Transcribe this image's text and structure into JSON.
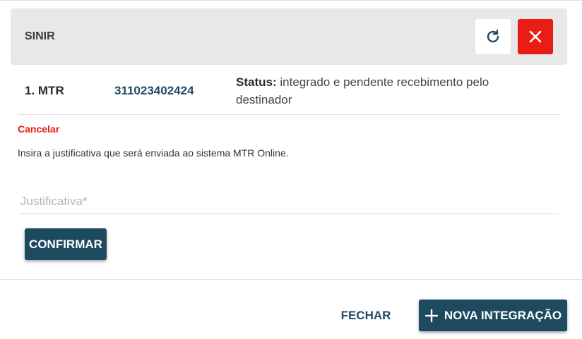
{
  "header": {
    "title": "SINIR",
    "refresh_icon": "refresh-icon",
    "close_icon": "close-icon",
    "close_color": "#ea1c16"
  },
  "mtr": {
    "label": "1. MTR",
    "number": "311023402424",
    "status_label": "Status:",
    "status_text": "integrado e pendente recebimento pelo destinador"
  },
  "cancel": {
    "link_label": "Cancelar",
    "hint": "Insira a justificativa que será enviada ao sistema MTR Online.",
    "field_placeholder": "Justificativa*",
    "field_value": "",
    "confirm_label": "CONFIRMAR"
  },
  "footer": {
    "close_label": "FECHAR",
    "new_label": "NOVA INTEGRAÇÃO",
    "new_icon": "plus-icon"
  },
  "colors": {
    "primary": "#1e4a60",
    "danger": "#e31b14",
    "header_bg": "#e8e8e8"
  }
}
